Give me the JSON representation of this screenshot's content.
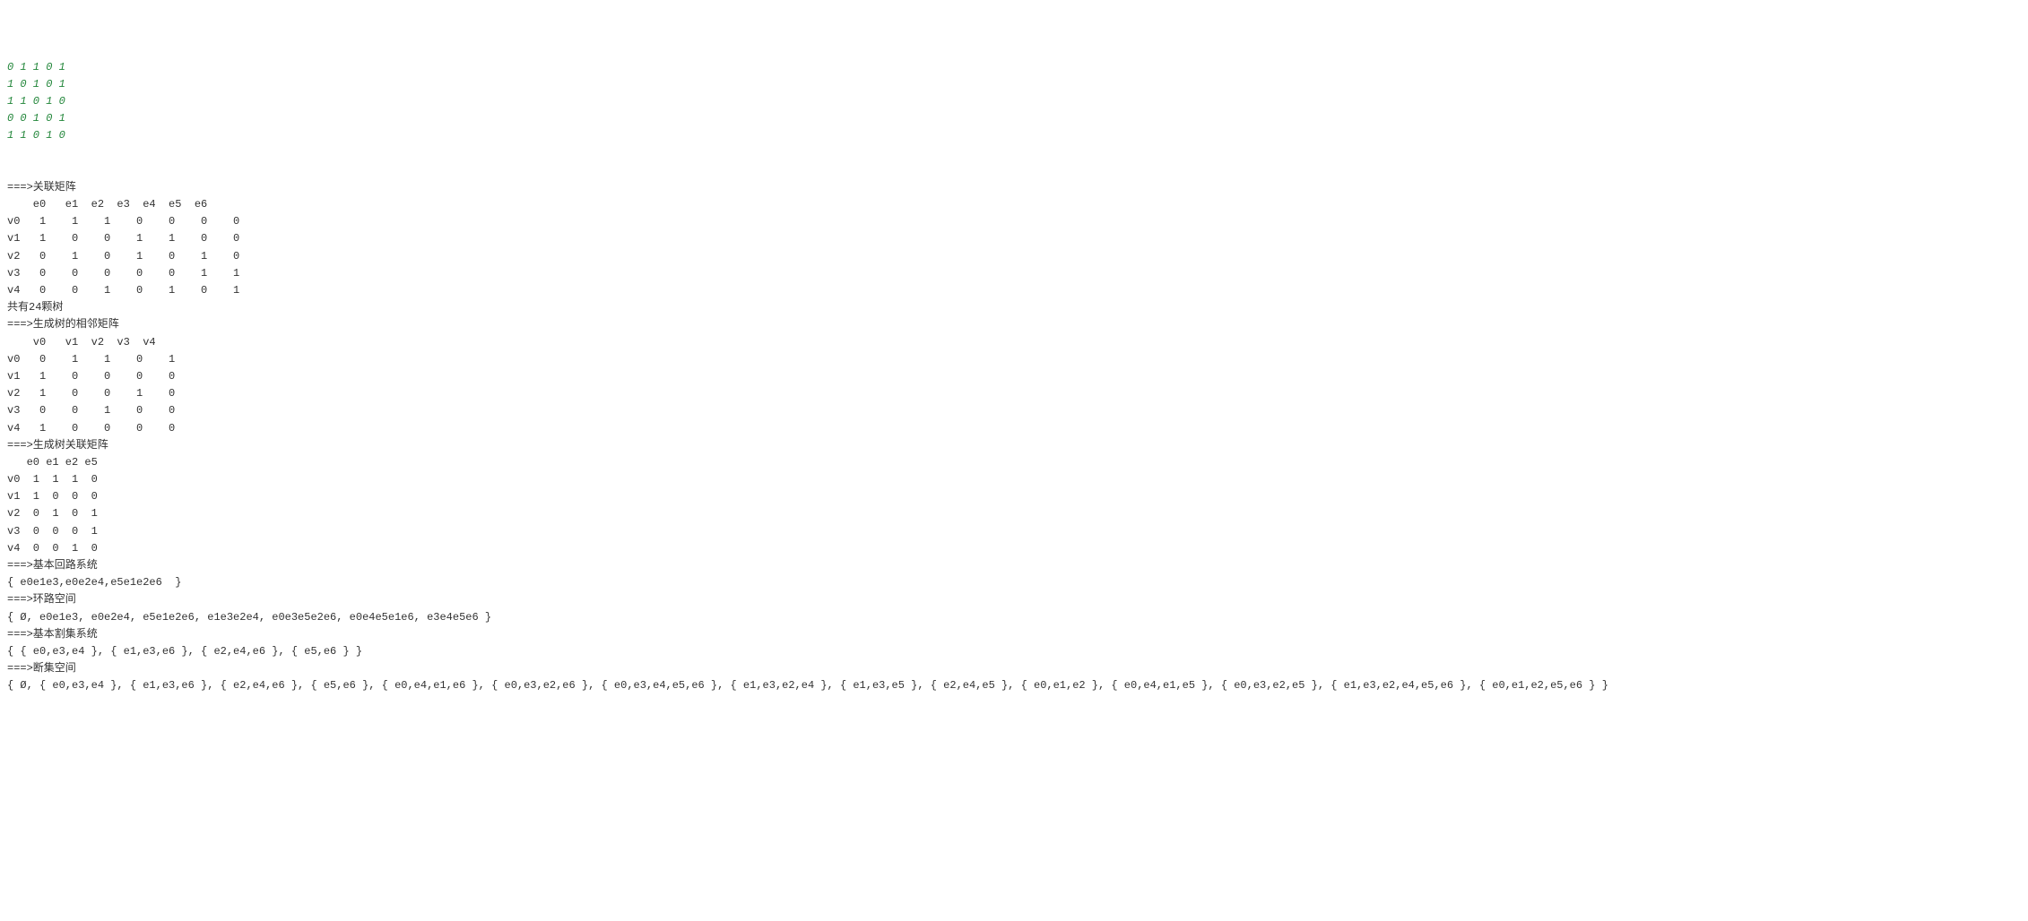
{
  "input_block": "0 1 1 0 1\n1 0 1 0 1\n1 1 0 1 0\n0 0 1 0 1\n1 1 0 1 0",
  "sections": {
    "incidence_matrix": {
      "title": "===>关联矩阵",
      "header": "    e0   e1  e2  e3  e4  e5  e6",
      "rows": [
        "v0   1    1    1    0    0    0    0",
        "v1   1    0    0    1    1    0    0",
        "v2   0    1    0    1    0    1    0",
        "v3   0    0    0    0    0    1    1",
        "v4   0    0    1    0    1    0    1"
      ]
    },
    "tree_count": "共有24颗树",
    "spanning_adj": {
      "title": "===>生成树的相邻矩阵",
      "header": "    v0   v1  v2  v3  v4",
      "rows": [
        "v0   0    1    1    0    1",
        "v1   1    0    0    0    0",
        "v2   1    0    0    1    0",
        "v3   0    0    1    0    0",
        "v4   1    0    0    0    0"
      ]
    },
    "spanning_inc": {
      "title": "===>生成树关联矩阵",
      "header": "   e0 e1 e2 e5",
      "rows": [
        "v0  1  1  1  0",
        "v1  1  0  0  0",
        "v2  0  1  0  1",
        "v3  0  0  0  1",
        "v4  0  0  1  0"
      ]
    },
    "basic_cycle": {
      "title": "===>基本回路系统",
      "content": "{ e0e1e3,e0e2e4,e5e1e2e6  }"
    },
    "cycle_space": {
      "title": "===>环路空间",
      "content": "{ Ø, e0e1e3, e0e2e4, e5e1e2e6, e1e3e2e4, e0e3e5e2e6, e0e4e5e1e6, e3e4e5e6 }"
    },
    "basic_cut": {
      "title": "===>基本割集系统",
      "content": "{ { e0,e3,e4 }, { e1,e3,e6 }, { e2,e4,e6 }, { e5,e6 } }"
    },
    "cut_space": {
      "title": "===>断集空间",
      "content": "{ Ø, { e0,e3,e4 }, { e1,e3,e6 }, { e2,e4,e6 }, { e5,e6 }, { e0,e4,e1,e6 }, { e0,e3,e2,e6 }, { e0,e3,e4,e5,e6 }, { e1,e3,e2,e4 }, { e1,e3,e5 }, { e2,e4,e5 }, { e0,e1,e2 }, { e0,e4,e1,e5 }, { e0,e3,e2,e5 }, { e1,e3,e2,e4,e5,e6 }, { e0,e1,e2,e5,e6 } }"
    }
  }
}
